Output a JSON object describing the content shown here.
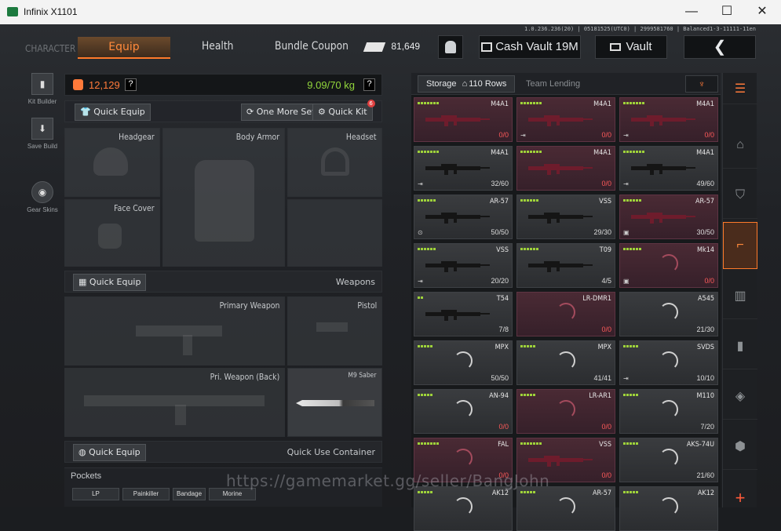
{
  "window": {
    "title": "Infinix X1101",
    "minimize": "—",
    "maximize": "☐",
    "close": "✕"
  },
  "server_info": "1.0.236.236(20) | 05181525(UTC0) | 2999581760 | Balanced1-3-11111-11en",
  "header": {
    "character": "CHARACTER",
    "tabs": [
      "Equip",
      "Health",
      "Bundle Coupon"
    ],
    "currency": "81,649",
    "cash_vault": "Cash Vault 19M",
    "vault": "Vault",
    "back": "❮"
  },
  "leftbar": [
    {
      "label": "Kit Builder",
      "icon": "kit-builder-icon"
    },
    {
      "label": "Save Build",
      "icon": "save-build-icon"
    },
    {
      "label": "Gear Skins",
      "icon": "gear-skins-icon"
    }
  ],
  "equip": {
    "value": "12,129",
    "help": "?",
    "weight": "9.09/70 kg",
    "quick_equip": "Quick Equip",
    "one_more_set": "One More Set",
    "quick_kit": "Quick Kit",
    "quick_kit_badge": "6",
    "slots": {
      "headgear": "Headgear",
      "body_armor": "Body Armor",
      "headset": "Headset",
      "face_cover": "Face Cover"
    },
    "weapons": "Weapons",
    "primary_weapon": "Primary Weapon",
    "pistol": "Pistol",
    "pri_weapon_back": "Pri. Weapon (Back)",
    "melee_name": "M9 Saber",
    "quick_use": "Quick Use Container",
    "pockets": "Pockets",
    "pocket_items": [
      "LP",
      "Painkiller",
      "Bandage",
      "Morine"
    ]
  },
  "storage": {
    "tab": "Storage",
    "rows": "110 Rows",
    "team_lending": "Team Lending",
    "items": [
      {
        "name": "M4A1",
        "amount": "0/0",
        "style": "red",
        "gun": true,
        "dots": 7,
        "corner": ""
      },
      {
        "name": "M4A1",
        "amount": "0/0",
        "style": "red",
        "gun": true,
        "dots": 7,
        "corner": "⇥"
      },
      {
        "name": "M4A1",
        "amount": "0/0",
        "style": "red",
        "gun": true,
        "dots": 7,
        "corner": "⇥"
      },
      {
        "name": "M4A1",
        "amount": "32/60",
        "style": "gray",
        "gun": true,
        "dots": 7,
        "corner": "⇥"
      },
      {
        "name": "M4A1",
        "amount": "0/0",
        "style": "red",
        "gun": true,
        "dots": 7,
        "corner": ""
      },
      {
        "name": "M4A1",
        "amount": "49/60",
        "style": "gray",
        "gun": true,
        "dots": 7,
        "corner": "⇥"
      },
      {
        "name": "AR-57",
        "amount": "50/50",
        "style": "gray",
        "gun": true,
        "dots": 6,
        "corner": "⊙"
      },
      {
        "name": "VSS",
        "amount": "29/30",
        "style": "gray",
        "gun": true,
        "dots": 6,
        "corner": ""
      },
      {
        "name": "AR-57",
        "amount": "30/50",
        "style": "red",
        "gun": true,
        "dots": 6,
        "corner": "▣"
      },
      {
        "name": "VSS",
        "amount": "20/20",
        "style": "gray",
        "gun": true,
        "dots": 6,
        "corner": "⇥"
      },
      {
        "name": "T09",
        "amount": "4/5",
        "style": "gray",
        "gun": true,
        "dots": 6,
        "corner": ""
      },
      {
        "name": "Mk14",
        "amount": "0/0",
        "style": "red",
        "gun": false,
        "dots": 6,
        "corner": "▣"
      },
      {
        "name": "T54",
        "amount": "7/8",
        "style": "gray",
        "gun": true,
        "dots": 2,
        "corner": ""
      },
      {
        "name": "LR-DMR1",
        "amount": "0/0",
        "style": "red",
        "gun": false,
        "dots": 0,
        "corner": ""
      },
      {
        "name": "A545",
        "amount": "21/30",
        "style": "gray",
        "gun": false,
        "dots": 0,
        "corner": ""
      },
      {
        "name": "MPX",
        "amount": "50/50",
        "style": "gray",
        "gun": false,
        "dots": 5,
        "corner": ""
      },
      {
        "name": "MPX",
        "amount": "41/41",
        "style": "gray",
        "gun": false,
        "dots": 5,
        "corner": ""
      },
      {
        "name": "SVDS",
        "amount": "10/10",
        "style": "gray",
        "gun": false,
        "dots": 5,
        "corner": "⇥"
      },
      {
        "name": "AN-94",
        "amount": "0/0",
        "style": "gray",
        "gun": false,
        "dots": 5,
        "corner": ""
      },
      {
        "name": "LR-AR1",
        "amount": "0/0",
        "style": "red",
        "gun": false,
        "dots": 5,
        "corner": ""
      },
      {
        "name": "M110",
        "amount": "7/20",
        "style": "gray",
        "gun": false,
        "dots": 5,
        "corner": ""
      },
      {
        "name": "FAL",
        "amount": "0/0",
        "style": "red",
        "gun": false,
        "dots": 7,
        "corner": ""
      },
      {
        "name": "VSS",
        "amount": "0/0",
        "style": "red",
        "gun": true,
        "dots": 7,
        "corner": ""
      },
      {
        "name": "AKS-74U",
        "amount": "21/60",
        "style": "gray",
        "gun": false,
        "dots": 5,
        "corner": ""
      },
      {
        "name": "AK12",
        "amount": "",
        "style": "gray",
        "gun": false,
        "dots": 5,
        "corner": ""
      },
      {
        "name": "AR-57",
        "amount": "",
        "style": "gray",
        "gun": false,
        "dots": 5,
        "corner": ""
      },
      {
        "name": "AK12",
        "amount": "",
        "style": "gray",
        "gun": false,
        "dots": 5,
        "corner": ""
      }
    ]
  },
  "rightnav": [
    "layers-icon",
    "home-icon",
    "armor-icon",
    "weapon-icon",
    "ammo-icon",
    "medical-icon",
    "grenade-icon",
    "misc-icon",
    "add-icon"
  ],
  "watermark": "https://gamemarket.gg/seller/BangJohn"
}
